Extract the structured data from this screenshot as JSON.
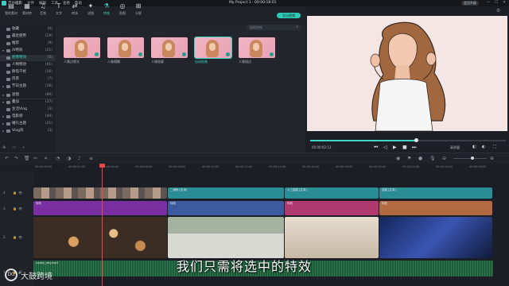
{
  "window": {
    "app_name": "万兴喵影",
    "menu": [
      "文件",
      "编辑",
      "工具",
      "查看",
      "帮助"
    ],
    "project_title": "My Project 1 : 00:00:18:01",
    "account_pill": "会员升级",
    "window_buttons": [
      "—",
      "☐",
      "✕"
    ]
  },
  "toolbar": {
    "items": [
      {
        "icon": "folder-icon",
        "glyph": "▤",
        "label": "我的素材"
      },
      {
        "icon": "stock-icon",
        "glyph": "▦",
        "label": "素材库"
      },
      {
        "icon": "music-icon",
        "glyph": "♫",
        "label": "音频"
      },
      {
        "icon": "text-icon",
        "glyph": "T",
        "label": "文字"
      },
      {
        "icon": "transition-icon",
        "glyph": "⇄",
        "label": "转场"
      },
      {
        "icon": "effects-icon",
        "glyph": "✦",
        "label": "滤镜"
      },
      {
        "icon": "ai-effects-icon",
        "glyph": "⚗",
        "label": "特效"
      },
      {
        "icon": "sticker-icon",
        "glyph": "◎",
        "label": "贴图"
      },
      {
        "icon": "split-icon",
        "glyph": "⊞",
        "label": "分屏"
      }
    ],
    "active_index": 6,
    "export_label": "导出视频"
  },
  "sidebar": {
    "items": [
      {
        "arrow": "",
        "name": "收藏",
        "count": "(0)"
      },
      {
        "arrow": "",
        "name": "最近使用",
        "count": "(19)"
      },
      {
        "arrow": "",
        "name": "推荐",
        "count": "(9)"
      },
      {
        "arrow": "▾",
        "name": "AI特效",
        "count": "(21)"
      },
      {
        "arrow": "",
        "name": "图像特效",
        "count": "(5)"
      },
      {
        "arrow": "",
        "name": "人物特效",
        "count": "(41)"
      },
      {
        "arrow": "",
        "name": "静电干扰",
        "count": "(16)"
      },
      {
        "arrow": "",
        "name": "风景",
        "count": "(7)"
      },
      {
        "arrow": "▸",
        "name": "节日主题",
        "count": "(16)"
      },
      {
        "arrow": "▸",
        "name": "滤镜",
        "count": "(89)"
      },
      {
        "arrow": "▾",
        "name": "叠加",
        "count": "(37)"
      },
      {
        "arrow": "",
        "name": "生活Vlog",
        "count": "(3)"
      },
      {
        "arrow": "▸",
        "name": "电影感",
        "count": "(44)"
      },
      {
        "arrow": "▸",
        "name": "婚礼主题",
        "count": "(21)"
      },
      {
        "arrow": "▸",
        "name": "Vlog风",
        "count": "(3)"
      }
    ],
    "selected_index": 4
  },
  "media": {
    "search_placeholder": "搜索特效",
    "items": [
      {
        "label": "人像边缘光"
      },
      {
        "label": "人像模糊"
      },
      {
        "label": "人像轮廓"
      },
      {
        "label": "自动抠像"
      },
      {
        "label": "人像描边"
      }
    ],
    "selected_index": 3
  },
  "preview": {
    "timecode": "00:00:02:13",
    "position_fraction": 0.54,
    "quality": "高质量",
    "controls": [
      "⏮",
      "◁",
      "▶",
      "■",
      "⏭"
    ]
  },
  "timeline": {
    "ruler_ticks": [
      "00:00:00:00",
      "00:00:02:00",
      "00:00:04:00",
      "00:00:06:00",
      "00:00:08:00",
      "00:00:10:00",
      "00:00:12:00",
      "00:00:14:00",
      "00:00:16:00",
      "00:00:18:00",
      "00:00:20:00",
      "00:00:22:00",
      "00:00:24:00",
      "00:00:26:00"
    ],
    "track_labels": [
      "4",
      "3",
      "2",
      "1",
      "1"
    ],
    "teal_clips": [
      "二维码 [文本]",
      "人工智能 [文本]",
      "技能 [文本]",
      "知识 [文本]"
    ],
    "effect_clips": [
      "特效",
      "特效",
      "特效",
      "特效"
    ],
    "audio_clip": "Lovely_day.mp3"
  },
  "overlay": {
    "subtitle": "我们只需将选中的特效",
    "watermark": "大鼓跨境",
    "watermark_logo": "DG"
  }
}
